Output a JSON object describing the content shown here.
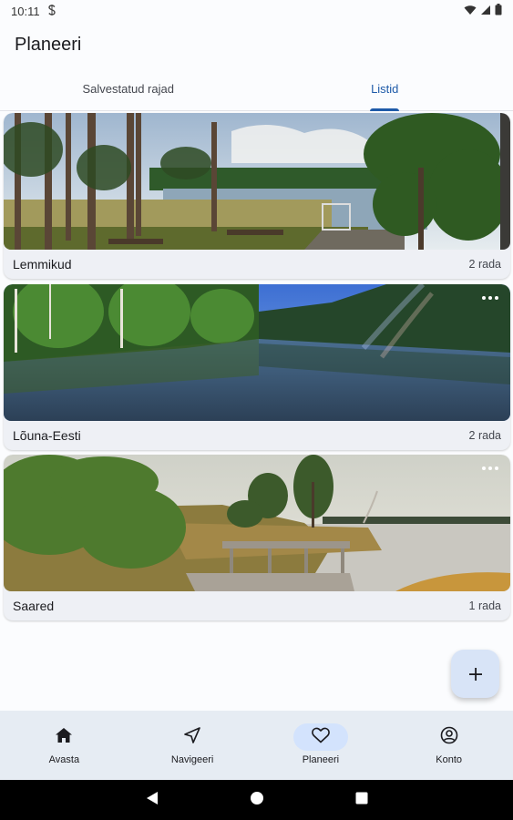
{
  "status_bar": {
    "time": "10:11",
    "notification_icon": "s-icon",
    "icons": [
      "wifi-icon",
      "signal-icon",
      "battery-icon"
    ]
  },
  "app_bar": {
    "title": "Planeeri"
  },
  "tabs": [
    {
      "label": "Salvestatud rajad",
      "active": false
    },
    {
      "label": "Listid",
      "active": true
    }
  ],
  "lists": [
    {
      "name": "Lemmikud",
      "count": "2 rada",
      "image": "pine-forest-lake-with-dock-photo"
    },
    {
      "name": "Lõuna-Eesti",
      "count": "2 rada",
      "image": "forest-river-reflection-photo"
    },
    {
      "name": "Saared",
      "count": "1 rada",
      "image": "bog-lake-boardwalk-photo"
    }
  ],
  "fab": {
    "icon": "plus-icon"
  },
  "bottom_nav": [
    {
      "label": "Avasta",
      "icon": "home-icon",
      "active": false
    },
    {
      "label": "Navigeeri",
      "icon": "navigation-arrow-icon",
      "active": false
    },
    {
      "label": "Planeeri",
      "icon": "heart-icon",
      "active": true
    },
    {
      "label": "Konto",
      "icon": "account-circle-icon",
      "active": false
    }
  ],
  "colors": {
    "accent": "#1e5aa8",
    "nav_background": "#e6ecf3",
    "active_pill": "#d3e3fd",
    "fab_background": "#d8e4f7"
  }
}
